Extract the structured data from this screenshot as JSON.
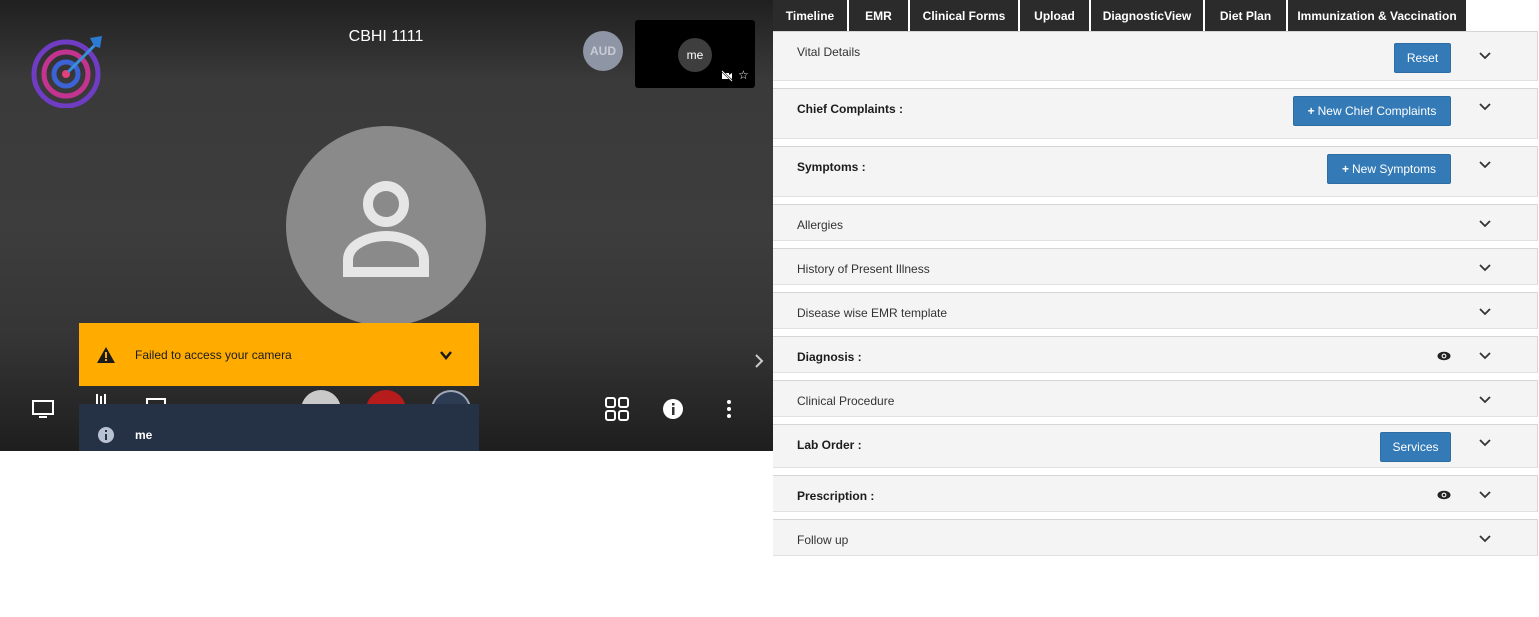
{
  "video": {
    "room_title": "CBHI 1111",
    "aud_badge": "AUD",
    "self_view_label": "me",
    "camera_error": "Failed to access your camera",
    "notification_name": "me"
  },
  "tabs": [
    "Timeline",
    "EMR",
    "Clinical Forms",
    "Upload",
    "DiagnosticView",
    "Diet Plan",
    "Immunization & Vaccination"
  ],
  "sections": {
    "vital": {
      "label": "Vital Details",
      "button": "Reset"
    },
    "chief": {
      "label": "Chief Complaints :",
      "button": "New Chief Complaints"
    },
    "symptoms": {
      "label": "Symptoms :",
      "button": "New Symptoms"
    },
    "allergies": {
      "label": "Allergies"
    },
    "hpi": {
      "label": "History of Present Illness"
    },
    "disease": {
      "label": "Disease wise EMR template"
    },
    "diagnosis": {
      "label": "Diagnosis :"
    },
    "procedure": {
      "label": "Clinical Procedure"
    },
    "lab": {
      "label": "Lab Order :",
      "button": "Services"
    },
    "prescription": {
      "label": "Prescription :"
    },
    "followup": {
      "label": "Follow up"
    }
  },
  "colors": {
    "accent_button": "#337ab7",
    "warning": "#ffab00",
    "tab_bg": "#2b2b2b"
  }
}
